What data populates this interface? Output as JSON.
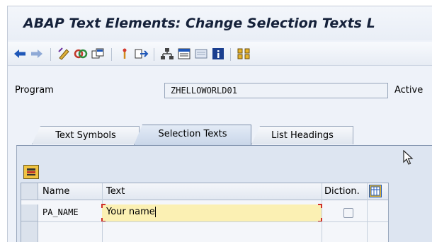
{
  "window": {
    "title": "ABAP Text Elements: Change Selection Texts L"
  },
  "toolbar": {
    "items": [
      {
        "icon": "back-arrow-icon"
      },
      {
        "icon": "forward-arrow-icon"
      },
      {
        "icon": "display-change-icon"
      },
      {
        "icon": "activate-icon"
      },
      {
        "icon": "other-object-icon"
      },
      {
        "icon": "where-used-icon"
      },
      {
        "icon": "navigate-icon"
      },
      {
        "icon": "hierarchy-icon"
      },
      {
        "icon": "layout-icon"
      },
      {
        "icon": "compare-icon"
      },
      {
        "icon": "info-icon"
      },
      {
        "icon": "find-icon"
      }
    ]
  },
  "program": {
    "label": "Program",
    "value": "ZHELLOWORLD01",
    "status": "Active"
  },
  "tabs": [
    {
      "label": "Text Symbols",
      "active": false
    },
    {
      "label": "Selection Texts",
      "active": true
    },
    {
      "label": "List Headings",
      "active": false
    }
  ],
  "table": {
    "columns": [
      "Name",
      "Text",
      "Diction."
    ],
    "rows": [
      {
        "name": "PA_NAME",
        "text": "Your name",
        "dictionary_ref": false
      }
    ]
  },
  "colors": {
    "accent": "#1b4f9c",
    "tab_active": "#c9d6e9",
    "edit_cell": "#fbf0b3",
    "cursor_frame": "#d0302a"
  }
}
